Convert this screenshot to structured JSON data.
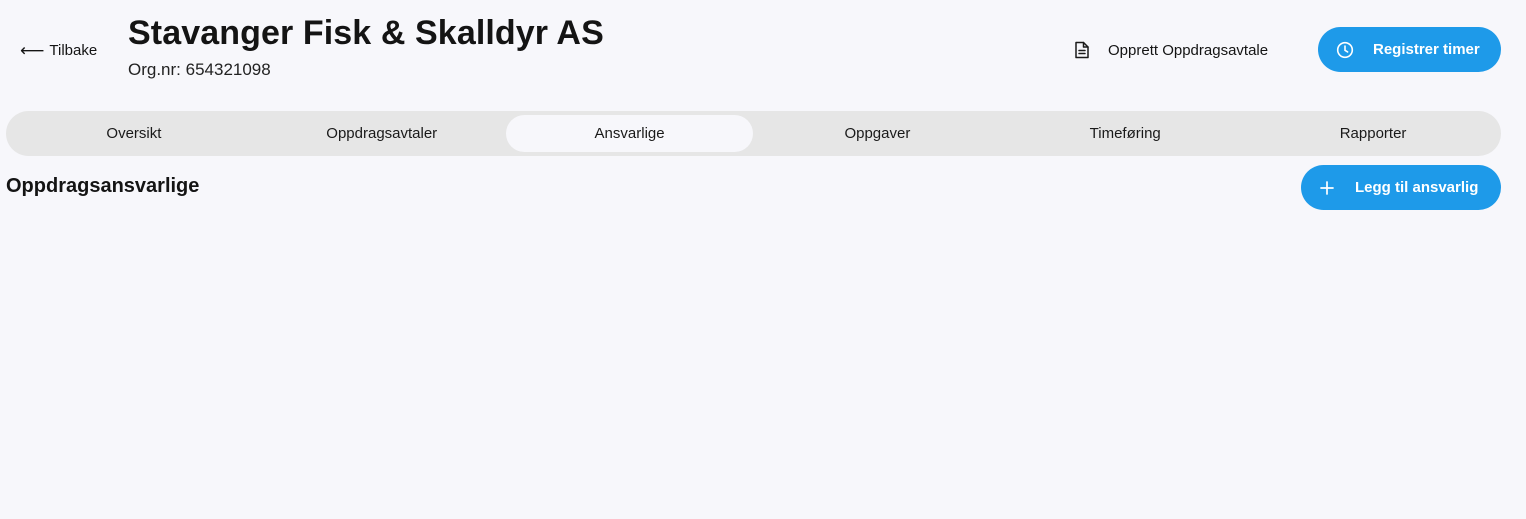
{
  "header": {
    "back_arrow": "⟵",
    "back_label": "Tilbake",
    "company_name": "Stavanger Fisk & Skalldyr AS",
    "org_number": "Org.nr: 654321098",
    "create_agreement_label": "Opprett Oppdragsavtale",
    "create_agreement_icon": "document-icon",
    "register_hours_label": "Registrer timer",
    "register_hours_icon": "clock-icon"
  },
  "tabs": [
    {
      "label": "Oversikt",
      "active": false
    },
    {
      "label": "Oppdragsavtaler",
      "active": false
    },
    {
      "label": "Ansvarlige",
      "active": true
    },
    {
      "label": "Oppgaver",
      "active": false
    },
    {
      "label": "Timeføring",
      "active": false
    },
    {
      "label": "Rapporter",
      "active": false
    }
  ],
  "section": {
    "title": "Oppdragsansvarlige",
    "add_button_label": "Legg til ansvarlig",
    "add_button_icon": "plus-icon"
  },
  "colors": {
    "accent": "#1e9ae9",
    "background": "#f7f7fb",
    "tab_bar": "#e6e6e6"
  }
}
